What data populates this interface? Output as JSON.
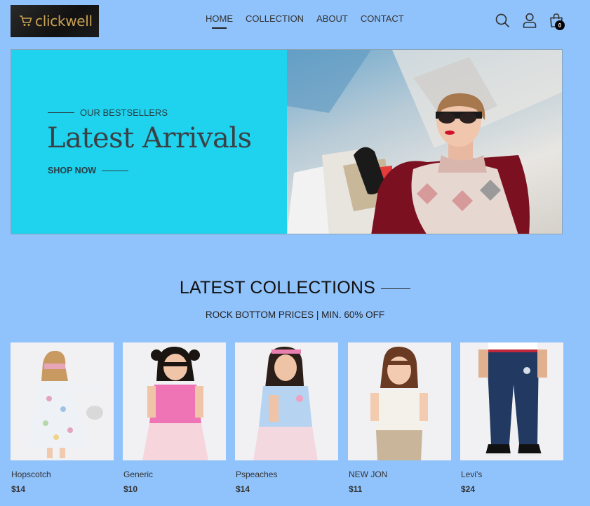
{
  "brand": {
    "name": "clickwell",
    "logo_icon": "cart-icon",
    "accent": "#c9a253"
  },
  "nav": {
    "items": [
      {
        "label": "HOME",
        "active": true
      },
      {
        "label": "COLLECTION",
        "active": false
      },
      {
        "label": "ABOUT",
        "active": false
      },
      {
        "label": "CONTACT",
        "active": false
      }
    ]
  },
  "header_icons": {
    "search": "search-icon",
    "account": "user-icon",
    "cart": "bag-icon",
    "cart_count": "0"
  },
  "hero": {
    "eyebrow": "OUR BESTSELLERS",
    "title": "Latest Arrivals",
    "cta": "SHOP NOW",
    "background": "#1fd3ee"
  },
  "collection": {
    "title": "LATEST COLLECTIONS",
    "subtitle": "ROCK BOTTOM PRICES | MIN. 60% OFF"
  },
  "products": [
    {
      "name": "Hopscotch",
      "price": "$14"
    },
    {
      "name": "Generic",
      "price": "$10"
    },
    {
      "name": "Pspeaches",
      "price": "$14"
    },
    {
      "name": "NEW JON",
      "price": "$11"
    },
    {
      "name": "Levi's",
      "price": "$24"
    }
  ],
  "colors": {
    "page_bg": "#90c2fb",
    "text": "#1f1f1f"
  }
}
